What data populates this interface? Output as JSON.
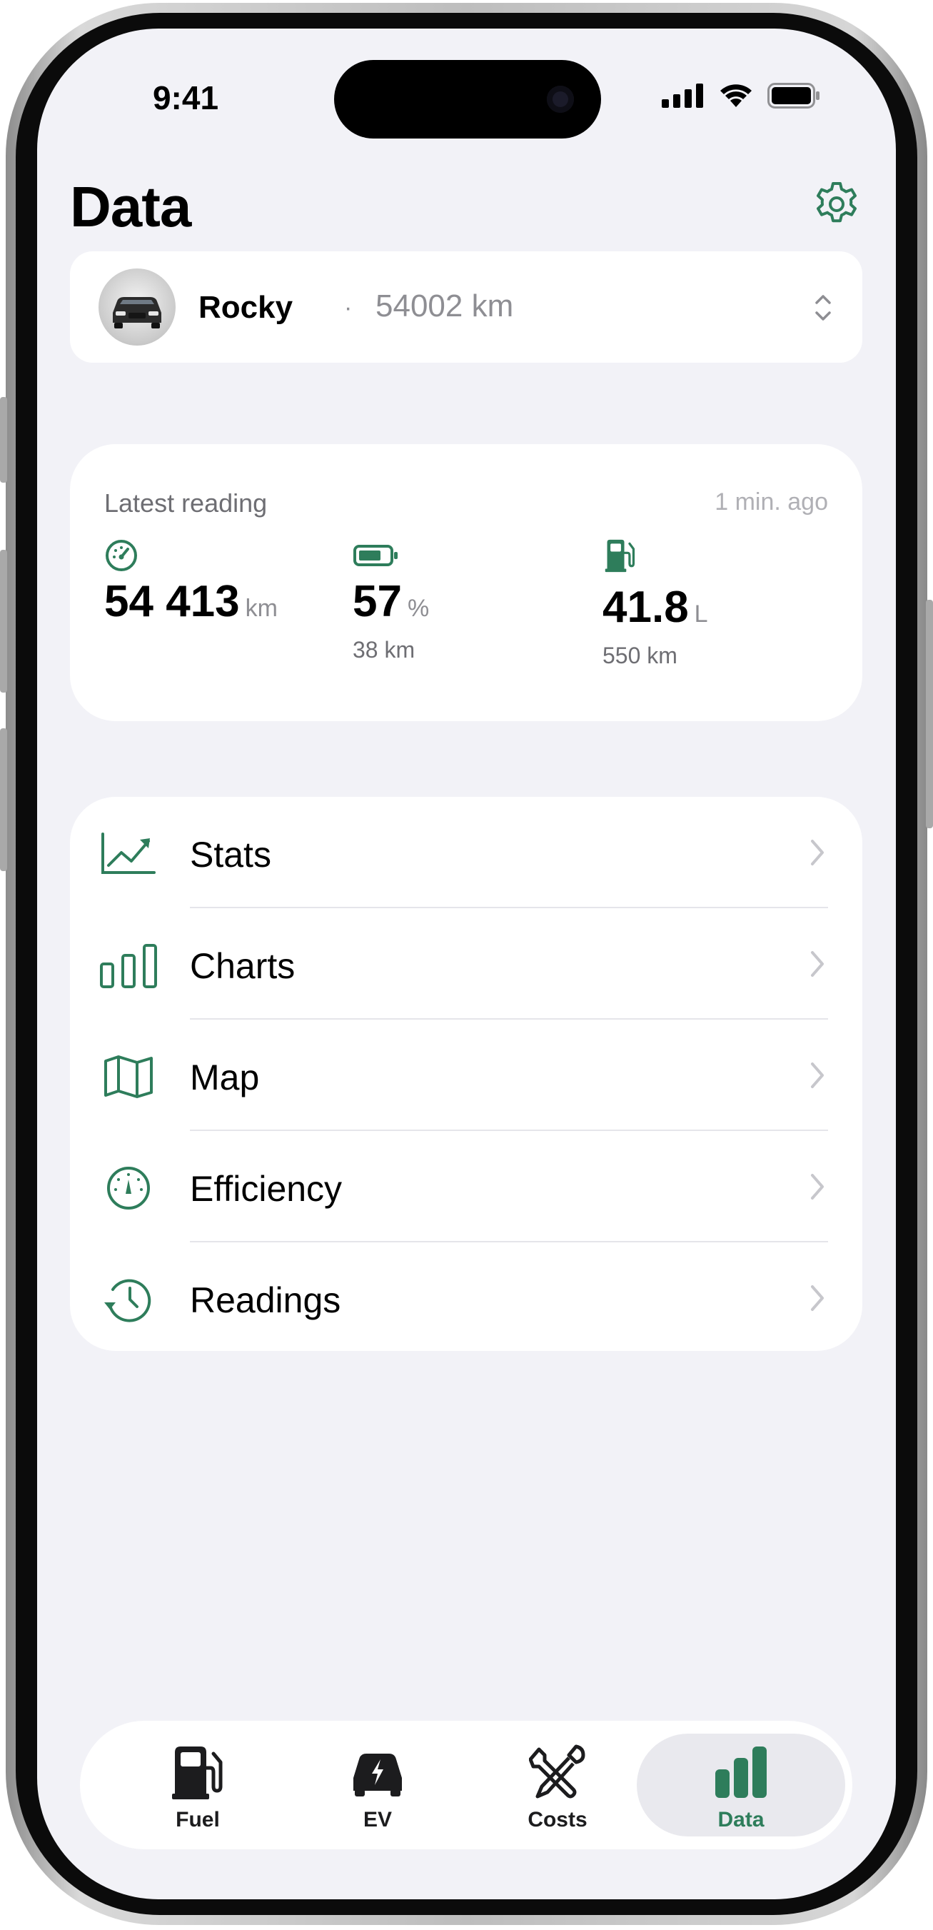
{
  "status_bar": {
    "time": "9:41"
  },
  "page": {
    "title": "Data"
  },
  "vehicle": {
    "name": "Rocky",
    "separator": "·",
    "odometer": "54002 km"
  },
  "latest_reading": {
    "title": "Latest reading",
    "time_ago": "1 min. ago",
    "odometer": {
      "value": "54 413",
      "unit": "km"
    },
    "battery": {
      "value": "57",
      "unit": "%",
      "range": "38 km"
    },
    "fuel": {
      "value": "41.8",
      "unit": "L",
      "range": "550 km"
    }
  },
  "menu": {
    "items": [
      {
        "label": "Stats",
        "icon": "trend-chart-icon"
      },
      {
        "label": "Charts",
        "icon": "bar-chart-icon"
      },
      {
        "label": "Map",
        "icon": "map-icon"
      },
      {
        "label": "Efficiency",
        "icon": "gauge-icon"
      },
      {
        "label": "Readings",
        "icon": "history-icon"
      }
    ]
  },
  "tabs": [
    {
      "label": "Fuel",
      "icon": "fuel-pump-icon",
      "active": false
    },
    {
      "label": "EV",
      "icon": "ev-car-icon",
      "active": false
    },
    {
      "label": "Costs",
      "icon": "tools-icon",
      "active": false
    },
    {
      "label": "Data",
      "icon": "bar-chart-icon",
      "active": true
    }
  ],
  "colors": {
    "accent": "#2e7d5b",
    "background": "#f2f2f7",
    "card": "#ffffff",
    "secondary_text": "#8e8e93"
  }
}
